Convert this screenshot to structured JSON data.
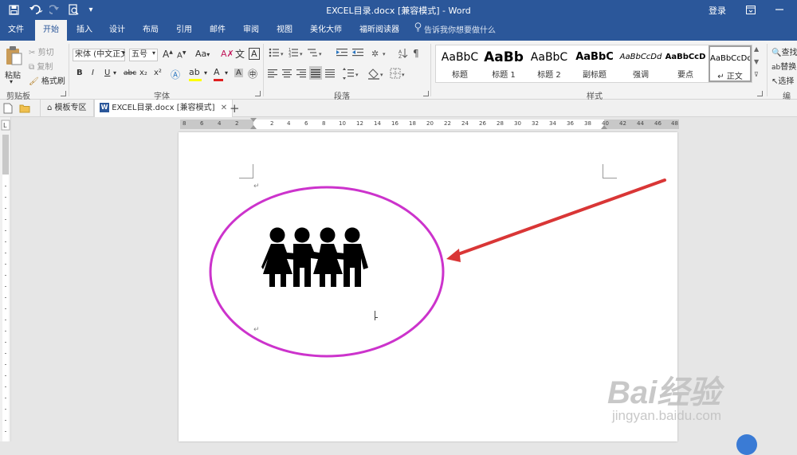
{
  "window": {
    "title": "EXCEL目录.docx [兼容模式]  -  Word",
    "login_label": "登录"
  },
  "colors": {
    "brand_blue": "#2b579a",
    "annotation_ellipse": "#cc33cc",
    "annotation_arrow": "#d93636"
  },
  "tabs": [
    "文件",
    "开始",
    "插入",
    "设计",
    "布局",
    "引用",
    "邮件",
    "审阅",
    "视图",
    "美化大师",
    "福昕阅读器"
  ],
  "tell_me": "告诉我你想要做什么",
  "clipboard": {
    "paste": "粘贴",
    "cut": "剪切",
    "copy": "复制",
    "format_painter": "格式刷",
    "label": "剪贴板"
  },
  "font": {
    "name": "宋体 (中文正文)",
    "size": "五号",
    "label": "字体",
    "bold": "B",
    "italic": "I",
    "underline": "U",
    "strikethrough": "abc",
    "subscript": "x₂",
    "superscript": "x²",
    "grow": "A",
    "shrink": "A",
    "case": "Aa",
    "wen": "文",
    "font_color": "A",
    "char_border": "A",
    "char_shade": "A"
  },
  "paragraph": {
    "label": "段落"
  },
  "styles": {
    "label": "样式",
    "items": [
      {
        "sample": "AaBbC",
        "name": "标题"
      },
      {
        "sample": "AaBb",
        "name": "标题 1"
      },
      {
        "sample": "AaBbC",
        "name": "标题 2"
      },
      {
        "sample": "AaBbC",
        "name": "副标题"
      },
      {
        "sample": "AaBbCcDd",
        "name": "强调"
      },
      {
        "sample": "AaBbCcD",
        "name": "要点"
      },
      {
        "sample": "AaBbCcDd",
        "name": "↵ 正文"
      }
    ]
  },
  "editing": {
    "label": "编辑",
    "find": "查找",
    "replace": "替换",
    "select": "选择"
  },
  "doc_tabs": [
    {
      "label": "模板专区"
    },
    {
      "label": "EXCEL目录.docx [兼容模式]"
    }
  ],
  "ruler": {
    "left_numbers": [
      "8",
      "6",
      "4",
      "2"
    ],
    "right_numbers": [
      "2",
      "4",
      "6",
      "8",
      "10",
      "12",
      "14",
      "16",
      "18",
      "20",
      "22",
      "24",
      "26",
      "28",
      "30",
      "32",
      "34",
      "36",
      "38",
      "40",
      "42",
      "44",
      "46",
      "48"
    ]
  },
  "document": {
    "paragraph_mark": "↵",
    "icon": "people-group-icon"
  },
  "watermark": {
    "logo": "Bai经验",
    "url": "jingyan.baidu.com"
  }
}
